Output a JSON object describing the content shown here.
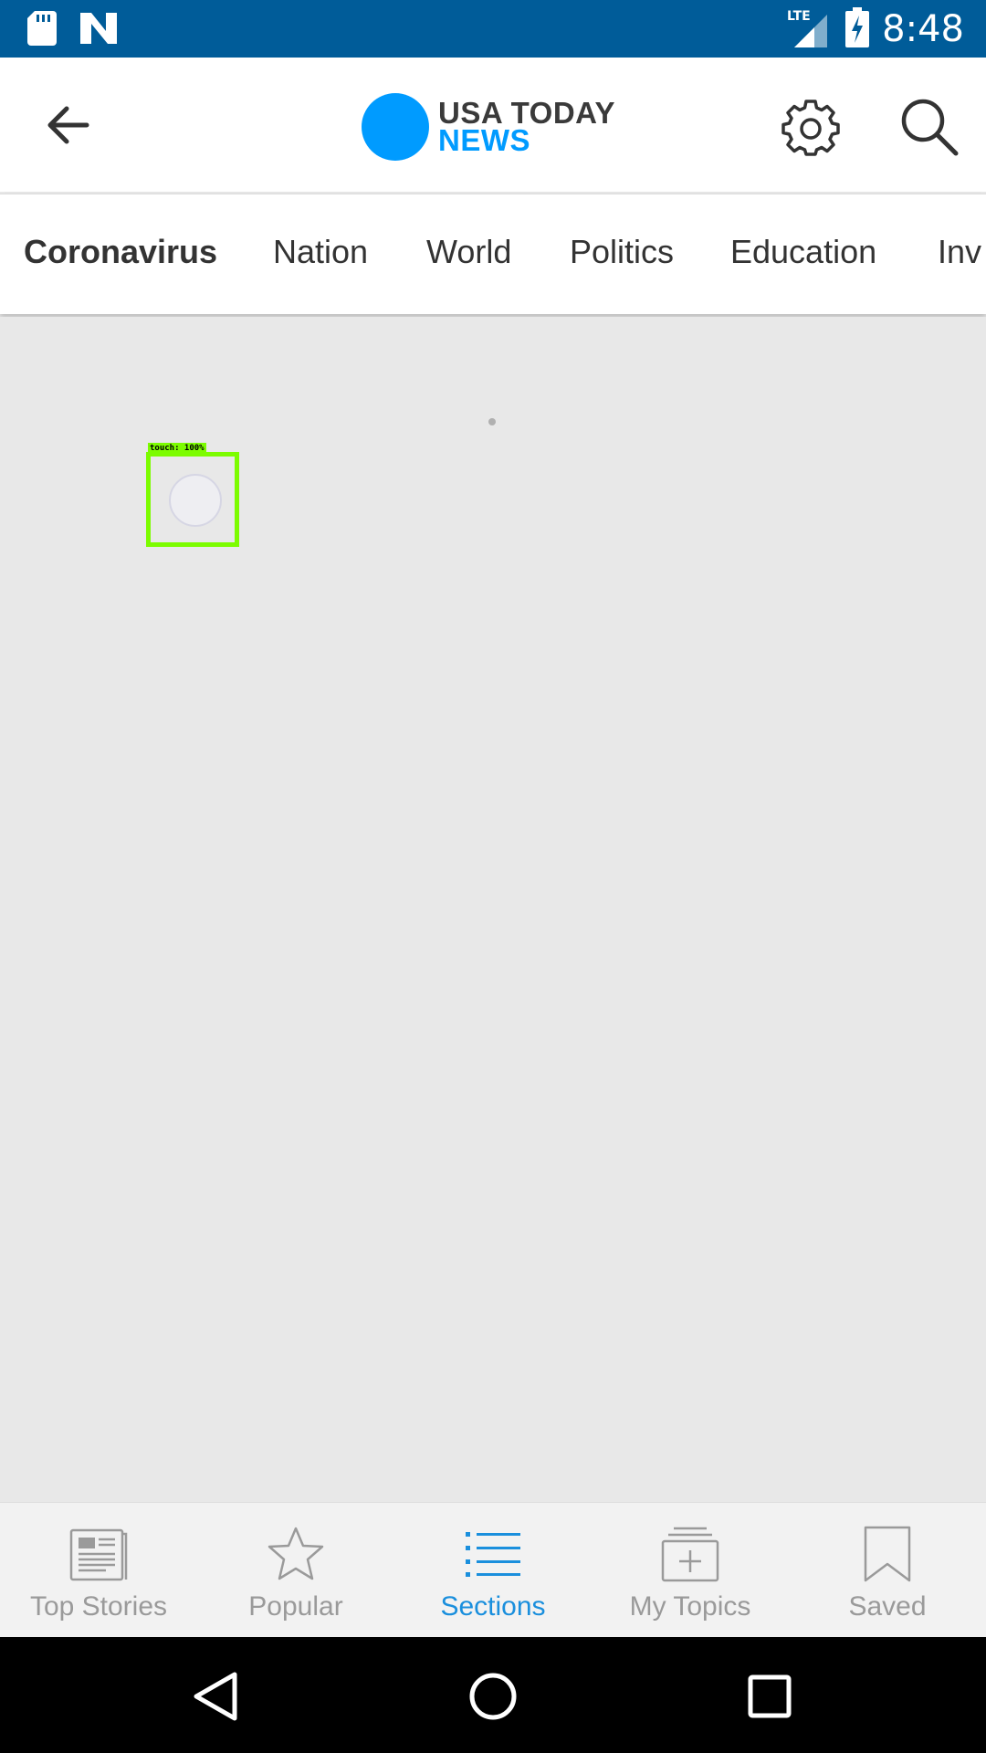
{
  "status_bar": {
    "time": "8:48",
    "network": "LTE",
    "icons": [
      "sd-card-icon",
      "n-notification-icon",
      "lte-signal-icon",
      "battery-charging-icon"
    ]
  },
  "app_bar": {
    "logo_line1": "USA TODAY",
    "logo_line2": "NEWS",
    "brand_color": "#009bff"
  },
  "tabs": [
    {
      "label": "Coronavirus",
      "active": true
    },
    {
      "label": "Nation",
      "active": false
    },
    {
      "label": "World",
      "active": false
    },
    {
      "label": "Politics",
      "active": false
    },
    {
      "label": "Education",
      "active": false
    },
    {
      "label": "Inv",
      "active": false
    }
  ],
  "overlay": {
    "touch_label": "touch: 100%"
  },
  "bottom_nav": {
    "items": [
      {
        "label": "Top Stories",
        "icon": "newspaper-icon",
        "active": false
      },
      {
        "label": "Popular",
        "icon": "star-icon",
        "active": false
      },
      {
        "label": "Sections",
        "icon": "list-icon",
        "active": true
      },
      {
        "label": "My Topics",
        "icon": "add-topics-icon",
        "active": false
      },
      {
        "label": "Saved",
        "icon": "bookmark-icon",
        "active": false
      }
    ],
    "active_color": "#1a8fdd",
    "inactive_color": "#9a9a9a"
  }
}
